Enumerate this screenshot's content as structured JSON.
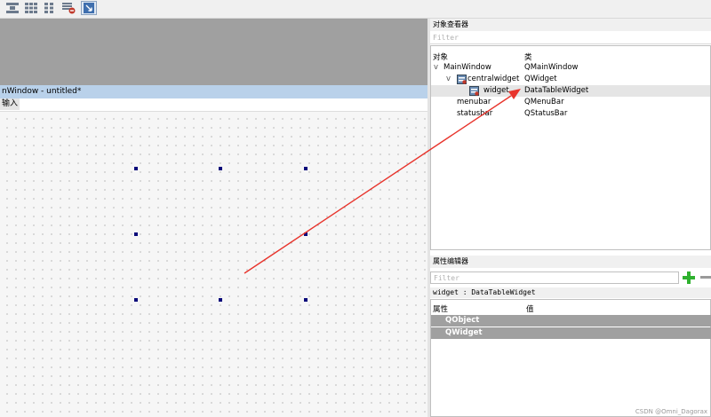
{
  "toolbar": {
    "buttons": [
      {
        "icon": "layout-horizontal-splitter-icon"
      },
      {
        "icon": "layout-grid-icon"
      },
      {
        "icon": "layout-form-icon"
      },
      {
        "icon": "break-layout-icon"
      },
      {
        "icon": "adjust-size-icon"
      }
    ]
  },
  "designer": {
    "form_title": "nWindow - untitled*",
    "menu_input": "输入"
  },
  "object_inspector": {
    "title": "对象查看器",
    "filter_placeholder": "Filter",
    "col_object": "对象",
    "col_class": "类",
    "rows": [
      {
        "object": "MainWindow",
        "class": "QMainWindow",
        "expander": "v"
      },
      {
        "object": "centralwidget",
        "class": "QWidget",
        "expander": "v"
      },
      {
        "object": "widget",
        "class": "DataTableWidget"
      },
      {
        "object": "menubar",
        "class": "QMenuBar"
      },
      {
        "object": "statusbar",
        "class": "QStatusBar"
      }
    ]
  },
  "property_editor": {
    "title": "属性编辑器",
    "filter_placeholder": "Filter",
    "object_line": "widget : DataTableWidget",
    "col_property": "属性",
    "col_value": "值",
    "groups": [
      "QObject",
      "QWidget"
    ]
  },
  "watermark": "CSDN @Omni_Dagorax",
  "colors": {
    "arrow": "#e8342c",
    "selection": "#e5e5e5",
    "group_header": "#a0a0a0",
    "title_bar": "#b9d1ea"
  }
}
